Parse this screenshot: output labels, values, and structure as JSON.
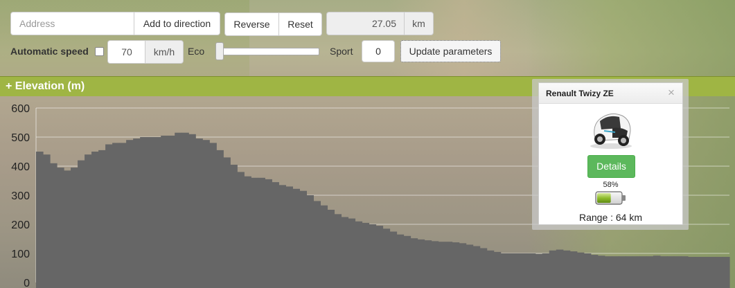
{
  "toolbar": {
    "address_placeholder": "Address",
    "add_to_direction_label": "Add to direction",
    "reverse_label": "Reverse",
    "reset_label": "Reset",
    "distance_value": "27.05",
    "distance_unit": "km",
    "automatic_speed_label": "Automatic speed",
    "automatic_speed_checked": false,
    "speed_value": "70",
    "speed_unit": "km/h",
    "eco_label": "Eco",
    "sport_label": "Sport",
    "eco_sport_slider_position": 0,
    "sport_value": "0",
    "update_parameters_label": "Update parameters"
  },
  "elevation": {
    "header_label": "+ Elevation (m)",
    "accent_color": "#9fb544",
    "fill_color": "#666666"
  },
  "chart_data": {
    "type": "area",
    "title": "+ Elevation (m)",
    "xlabel": "",
    "ylabel": "",
    "ylim": [
      0,
      600
    ],
    "yticks": [
      "0",
      "100",
      "200",
      "300",
      "400",
      "500",
      "600"
    ],
    "grid": true,
    "x": [
      0,
      1,
      2,
      3,
      4,
      5,
      6,
      7,
      8,
      9,
      10,
      11,
      12,
      13,
      14,
      15,
      16,
      17,
      18,
      19,
      20,
      21,
      22,
      23,
      24,
      25,
      26,
      27,
      28,
      29,
      30,
      31,
      32,
      33,
      34,
      35,
      36,
      37,
      38,
      39,
      40,
      41,
      42,
      43,
      44,
      45,
      46,
      47,
      48,
      49,
      50,
      51,
      52,
      53,
      54,
      55,
      56,
      57,
      58,
      59,
      60,
      61,
      62,
      63,
      64,
      65,
      66,
      67,
      68,
      69,
      70,
      71,
      72,
      73,
      74,
      75,
      76,
      77,
      78,
      79,
      80,
      81,
      82,
      83,
      84,
      85,
      86,
      87,
      88,
      89,
      90,
      91,
      92,
      93,
      94,
      95,
      96,
      97,
      98,
      99,
      100
    ],
    "series": [
      {
        "values": [
          450,
          440,
          410,
          395,
          385,
          395,
          420,
          440,
          450,
          455,
          475,
          480,
          480,
          490,
          495,
          500,
          500,
          500,
          505,
          505,
          515,
          515,
          510,
          495,
          490,
          480,
          455,
          430,
          405,
          380,
          365,
          360,
          360,
          355,
          345,
          335,
          330,
          322,
          315,
          300,
          280,
          265,
          250,
          235,
          225,
          220,
          210,
          205,
          200,
          195,
          185,
          175,
          165,
          160,
          152,
          148,
          145,
          142,
          140,
          140,
          138,
          135,
          130,
          125,
          118,
          110,
          105,
          100,
          100,
          100,
          100,
          100,
          98,
          100,
          110,
          113,
          110,
          107,
          103,
          100,
          95,
          92,
          90,
          90,
          90,
          90,
          90,
          90,
          90,
          92,
          90,
          90,
          90,
          90,
          88,
          88,
          88,
          88,
          88,
          88,
          88
        ]
      }
    ]
  },
  "popup": {
    "title": "Renault Twizy ZE",
    "close_glyph": "×",
    "car_image_icon": "car-image",
    "details_label": "Details",
    "details_color": "#5cb85c",
    "battery_percent_text": "58%",
    "battery_level": 0.58,
    "battery_icon": "battery-icon",
    "range_text": "Range : 64 km"
  }
}
